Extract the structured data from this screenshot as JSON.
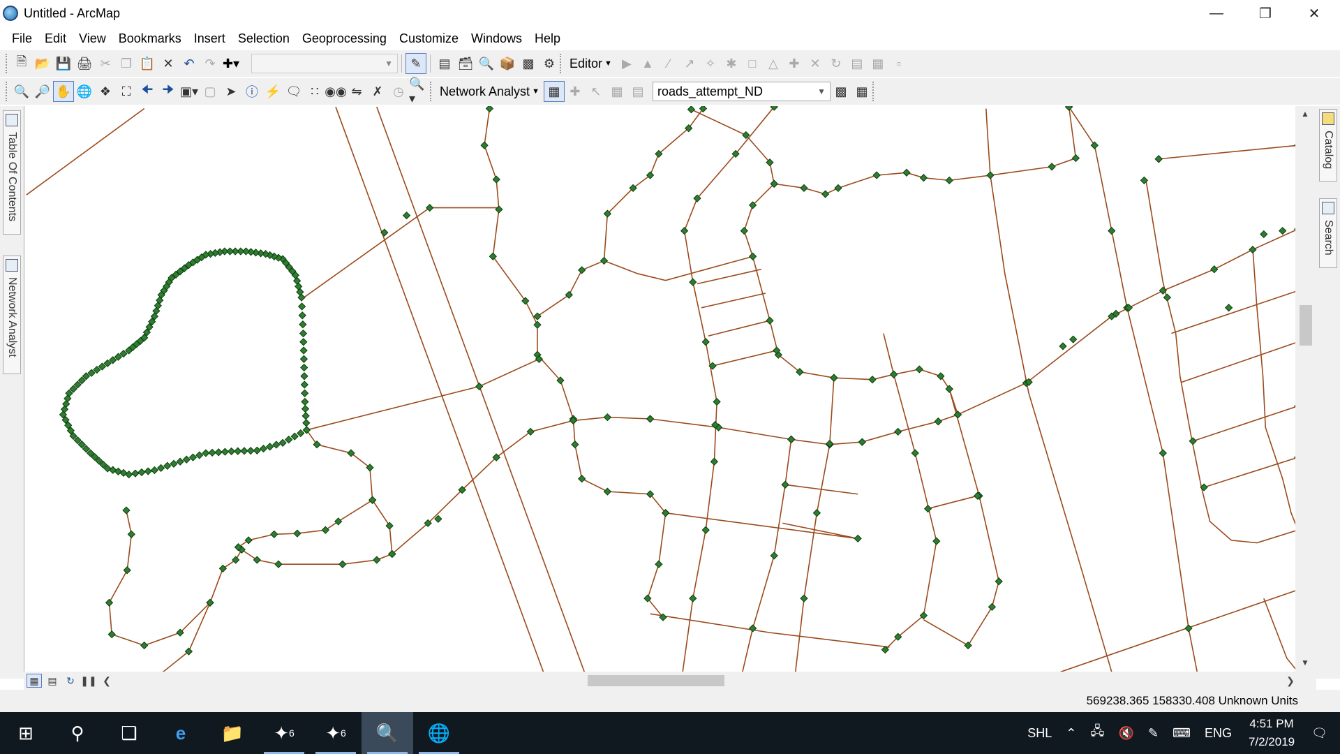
{
  "window": {
    "title": "Untitled - ArcMap"
  },
  "menu": {
    "items": [
      "File",
      "Edit",
      "View",
      "Bookmarks",
      "Insert",
      "Selection",
      "Geoprocessing",
      "Customize",
      "Windows",
      "Help"
    ]
  },
  "toolbar1": {
    "scale_value": "",
    "editor_label": "Editor"
  },
  "toolbar2": {
    "network_analyst_label": "Network Analyst",
    "network_dataset_value": "roads_attempt_ND"
  },
  "left_dock": {
    "toc_label": "Table Of Contents",
    "na_label": "Network Analyst"
  },
  "right_dock": {
    "catalog_label": "Catalog",
    "search_label": "Search"
  },
  "status": {
    "coordinates": "569238.365  158330.408 Unknown Units"
  },
  "taskbar": {
    "badge1": "6",
    "badge2": "6",
    "tray_shl": "SHL",
    "tray_lang": "ENG",
    "clock_time": "4:51 PM",
    "clock_date": "7/2/2019"
  },
  "colors": {
    "road_line": "#9b4a1c",
    "junction_fill": "#2e7d32",
    "junction_stroke": "#0b3d0b"
  }
}
